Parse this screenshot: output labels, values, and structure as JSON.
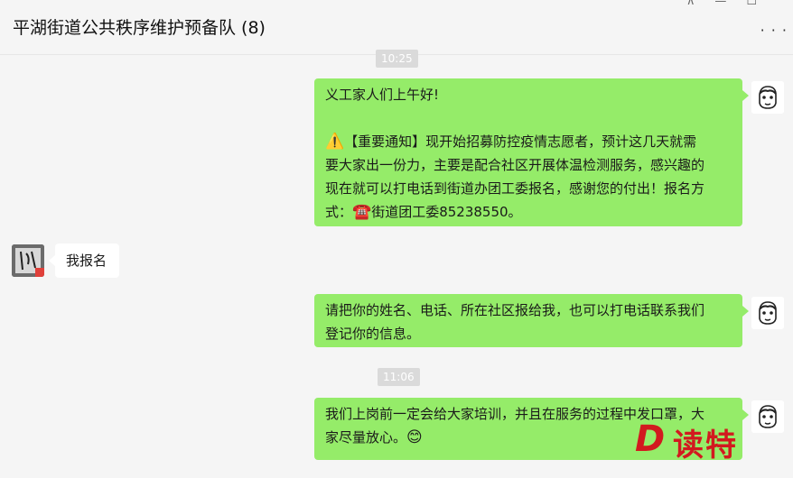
{
  "header": {
    "title": "平湖街道公共秩序维护预备队 (8)",
    "pin_icon": "pin-icon",
    "minimize_icon": "minimize-icon",
    "more_icon": "more-icon"
  },
  "messages": {
    "time1": "10:25",
    "msg1": {
      "line1": "义工家人们上午好!",
      "line2_icon": "⚠️",
      "line2": "【重要通知】现开始招募防控疫情志愿者，预计这几天就需",
      "line3": "要大家出一份力，主要是配合社区开展体温检测服务，感兴趣的",
      "line4": "现在就可以打电话到街道办团工委报名，感谢您的付出！报名方",
      "line5a": "式：",
      "line5_icon": "☎️",
      "line5b": "街道团工委85238550。"
    },
    "msg2": "我报名",
    "msg3": {
      "line1": "请把你的姓名、电话、所在社区报给我，也可以打电话联系我们",
      "line2": "登记你的信息。"
    },
    "time2": "11:06",
    "msg4": {
      "line1": "我们上岗前一定会给大家培训，并且在服务的过程中发口罩，大",
      "line2": "家尽量放心。",
      "emoji": "😊"
    }
  },
  "watermark": {
    "letter": "D",
    "text": "读特"
  }
}
